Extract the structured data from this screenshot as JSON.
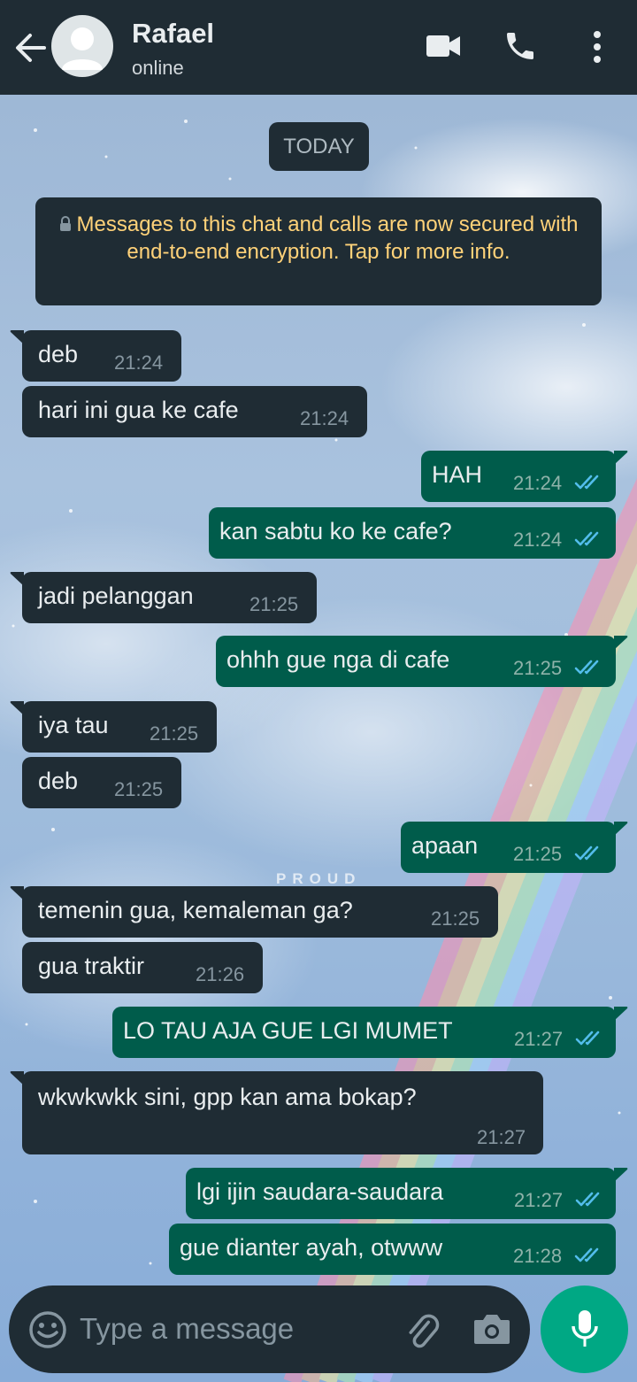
{
  "header": {
    "contact_name": "Rafael",
    "status": "online",
    "bg_color": "#1f2c34",
    "icons": [
      "back-arrow-icon",
      "avatar-placeholder-icon",
      "video-call-icon",
      "phone-icon",
      "more-vert-icon"
    ]
  },
  "chat": {
    "date_label": "TODAY",
    "encryption_notice": "Messages to this chat and calls are now secured with end-to-end encryption. Tap for more info.",
    "wallpaper_text": "PROUD",
    "messages": [
      {
        "dir": "in",
        "text": "deb",
        "time": "21:24"
      },
      {
        "dir": "in",
        "text": "hari ini gua ke cafe",
        "time": "21:24"
      },
      {
        "dir": "out",
        "text": "HAH",
        "time": "21:24",
        "status": "read"
      },
      {
        "dir": "out",
        "text": "kan sabtu ko ke cafe?",
        "time": "21:24",
        "status": "read"
      },
      {
        "dir": "in",
        "text": "jadi pelanggan",
        "time": "21:25"
      },
      {
        "dir": "out",
        "text": "ohhh gue nga di cafe",
        "time": "21:25",
        "status": "read"
      },
      {
        "dir": "in",
        "text": "iya tau",
        "time": "21:25"
      },
      {
        "dir": "in",
        "text": "deb",
        "time": "21:25"
      },
      {
        "dir": "out",
        "text": "apaan",
        "time": "21:25",
        "status": "read"
      },
      {
        "dir": "in",
        "text": "temenin gua, kemaleman ga?",
        "time": "21:25"
      },
      {
        "dir": "in",
        "text": "gua traktir",
        "time": "21:26"
      },
      {
        "dir": "out",
        "text": "LO TAU AJA GUE LGI MUMET",
        "time": "21:27",
        "status": "read"
      },
      {
        "dir": "in",
        "text": "wkwkwkk sini, gpp kan ama bokap?",
        "time": "21:27"
      },
      {
        "dir": "out",
        "text": "lgi ijin saudara-saudara",
        "time": "21:27",
        "status": "read"
      },
      {
        "dir": "out",
        "text": "gue dianter ayah, otwww",
        "time": "21:28",
        "status": "read"
      }
    ],
    "colors": {
      "incoming_bubble": "#1f2c34",
      "outgoing_bubble": "#005c4b",
      "notice_text": "#ffd279",
      "read_tick": "#53bdeb"
    }
  },
  "composer": {
    "placeholder": "Type a message",
    "icons": [
      "emoji-icon",
      "attach-icon",
      "camera-icon",
      "mic-icon"
    ],
    "mic_color": "#00a884"
  }
}
